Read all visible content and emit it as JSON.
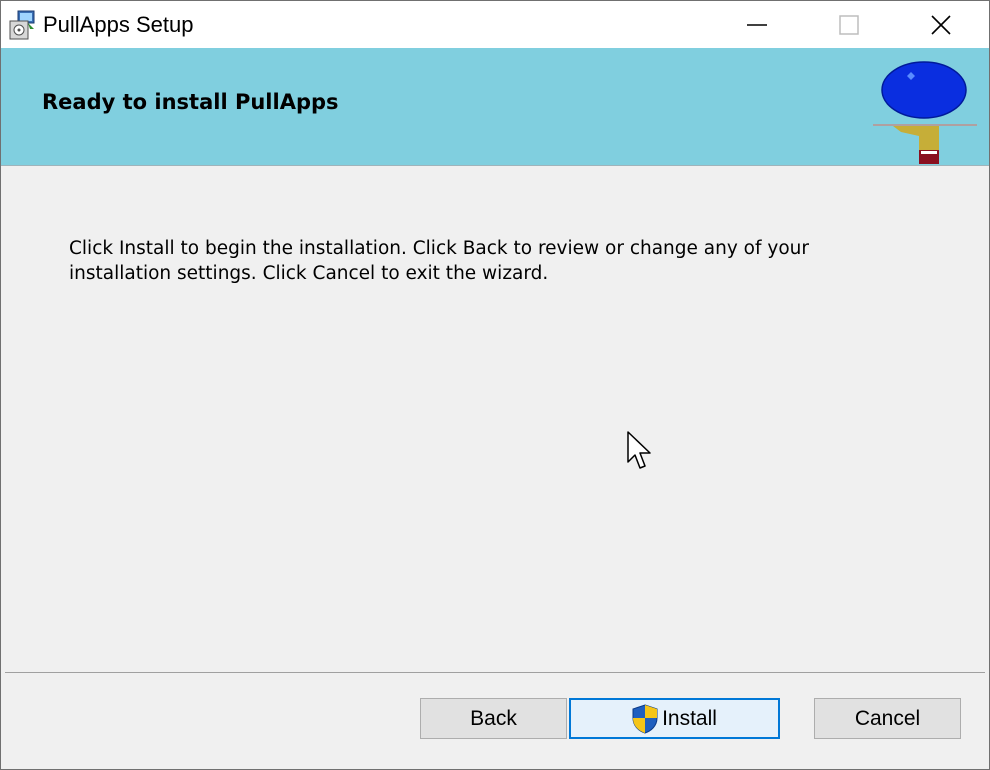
{
  "window": {
    "title": "PullApps Setup"
  },
  "titlebar": {
    "minimize_icon": "minimize-icon",
    "maximize_icon": "maximize-icon",
    "close_icon": "close-icon"
  },
  "header": {
    "title": "Ready to install PullApps"
  },
  "body": {
    "line1": "Click Install to begin the installation. Click Back to review or change any of your",
    "line2": "installation settings. Click Cancel to exit the wizard."
  },
  "buttons": {
    "back": "Back",
    "install": "Install",
    "cancel": "Cancel"
  },
  "colors": {
    "header_bg": "#80cfdf",
    "accent": "#0078d7",
    "logo_blue": "#0a2ee0",
    "logo_gold": "#c6ae38"
  }
}
